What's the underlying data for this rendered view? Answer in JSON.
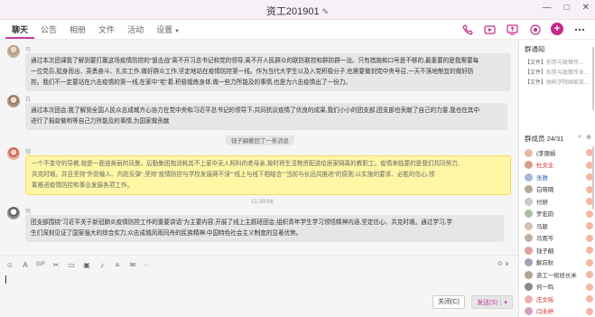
{
  "window": {
    "title": "资工201901",
    "edit_icon": "pencil-icon",
    "controls": [
      "—",
      "□",
      "✕"
    ]
  },
  "tabs": [
    {
      "label": "聊天",
      "active": true
    },
    {
      "label": "公告",
      "active": false
    },
    {
      "label": "相册",
      "active": false
    },
    {
      "label": "文件",
      "active": false
    },
    {
      "label": "活动",
      "active": false
    },
    {
      "label": "设置",
      "active": false
    }
  ],
  "messages": [
    {
      "sender": "马雨岑",
      "lines": [
        "通过本次团课我了解到要打赢这场疫情防控的\"狙击战\"离不开习总书记和党的领导,离不开人民群众的联防联控和群防群一治。只有措施和口号是不够的,最重要的是我需要每",
        "一位党员,挺身而出、英勇奋斗、扎实工作,做好群众工作,坚定地站在疫情防控第一线。作为当代大学生以及入党积极分子,也需要做到党中央号召,一天不落地制宜的做好防",
        "控。我们不一定要站在六击疫情的第一线,在家中\"宅\"着,积极锻炼身体,做一些力所能及的事情,也是为六击疫情出了一份力。"
      ]
    },
    {
      "sender": "白晓璐",
      "lines": [
        "通过本次团会,我了解到全国人民众志成城齐心协力在党中央和习近平总书记的领导下,共同抗议疫情了优良的成果,我们小小的团支部,团支部也贡献了自己的力量,我也在其中",
        "进行了捐款做哟等自己力所能及的事情,为国家做贡献"
      ]
    },
    {
      "notice": "钱子翩撤回了一条消息"
    },
    {
      "sender": "钱子翩",
      "highlight": true,
      "lines": [
        "一个不变守的导教,就是一面道美丽的风景。后勤集团抱消耗其不上家中无人照料的老母亲,按时将生活物资配送给居家隔离的教职工。疫情来临要的是我们共同努力,",
        "共克时艰。并且坚持\"外防输入、内防反弹\",坚持\"疫情防控与学校发展两不误\"\"线上与线下相结合\"\"当前与长远共推进\"的原则,以实施的要求、必胜的信心,领",
        "筹推进疫情防控和事业发展各项工作。"
      ]
    },
    {
      "time": "21:30:56"
    },
    {
      "sender": "何一鸣",
      "lines": [
        "团支部围绕\"习近平关于新冠肺炎疫情防控工作的重要讲话\"为主要内容,开展了线上主题班团会,组织青年学生学习领悟精神内涵,坚定信心、共克时艰。通过学习,学",
        "生们深刻见证了国家强大的综合实力,众志成城风雨同舟的民族精神,中国特色社会主义制度的显著优势。"
      ]
    }
  ],
  "input_bar": {
    "tools": [
      "emoji-icon",
      "font-icon",
      "gif-icon",
      "scissors-icon",
      "folder-icon",
      "image-icon",
      "mic-icon",
      "more-icon",
      "red-packet-icon",
      "more-icon-2"
    ],
    "tool_texts": [
      "",
      "",
      "GIF",
      "",
      "",
      "",
      "",
      "",
      "",
      "..."
    ],
    "history_label": "⊙ ∨",
    "close_label": "关闭(C)",
    "send_label": "发送(S)"
  },
  "right_panel": {
    "notice_title": "群通知",
    "files": [
      {
        "tag": "【文件】",
        "name": "形势与政策作..."
      },
      {
        "tag": "【文件】",
        "name": "形势与政策作业..."
      },
      {
        "tag": "【文件】",
        "name": "独科学院国家奖..."
      }
    ],
    "members_title": "群成员 24/31",
    "members": [
      {
        "name": "(李丽娟",
        "style": "normal",
        "color": "#e6b8a8"
      },
      {
        "name": "杜文业",
        "style": "red",
        "color": "#d9a089"
      },
      {
        "name": "张雅",
        "style": "blue",
        "color": "#a8b8d8"
      },
      {
        "name": "白晓璐",
        "style": "normal",
        "color": "#b8a898"
      },
      {
        "name": "付妍",
        "style": "normal",
        "color": "#c8c8c8"
      },
      {
        "name": "罗宏韵",
        "style": "normal",
        "color": "#a8c0a0"
      },
      {
        "name": "马颖",
        "style": "normal",
        "color": "#d8c0b0"
      },
      {
        "name": "马雨岑",
        "style": "normal",
        "color": "#c0b0a0"
      },
      {
        "name": "钱子翩",
        "style": "normal",
        "color": "#e0a0a0"
      },
      {
        "name": "解向秋",
        "style": "normal",
        "color": "#a0a0b8"
      },
      {
        "name": "资工一班班长米",
        "style": "normal",
        "color": "#b0a090"
      },
      {
        "name": "何一鸣",
        "style": "normal",
        "color": "#888"
      },
      {
        "name": "庄文瑶",
        "style": "red",
        "color": "#f0b0b0"
      },
      {
        "name": "闫永婷",
        "style": "red",
        "color": "#d0a0c0"
      }
    ]
  }
}
